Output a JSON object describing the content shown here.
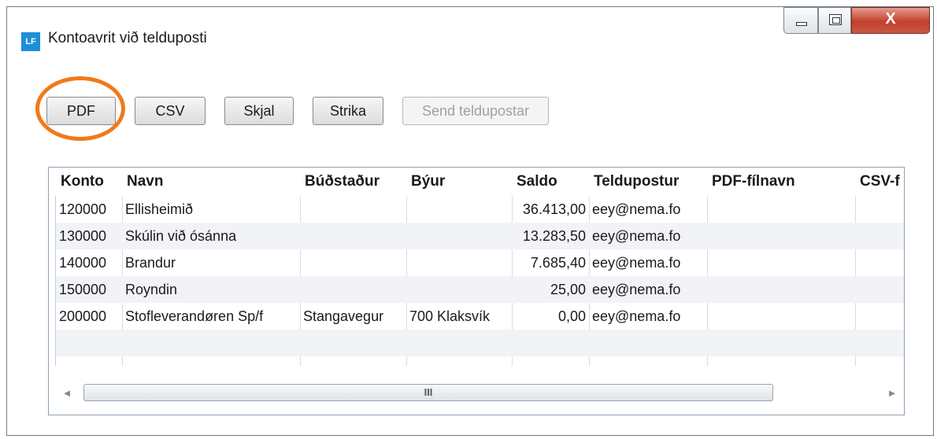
{
  "window": {
    "app_icon": "LF",
    "title": "Kontoavrit við telduposti",
    "controls": {
      "minimize": "minimize-icon",
      "maximize": "maximize-icon",
      "close_label": "X"
    }
  },
  "toolbar": {
    "pdf": "PDF",
    "csv": "CSV",
    "skjal": "Skjal",
    "strika": "Strika",
    "send": "Send teldupostar"
  },
  "highlight": {
    "target": "PDF",
    "color": "#f07a1a"
  },
  "grid": {
    "columns": [
      "Konto",
      "Navn",
      "Búðstaður",
      "Býur",
      "Saldo",
      "Teldupostur",
      "PDF-fílnavn",
      "CSV-f"
    ],
    "rows": [
      {
        "konto": "120000",
        "navn": "Ellisheimið",
        "budstadur": "",
        "byur": "",
        "saldo": "36.413,00",
        "email": "eey@nema.fo"
      },
      {
        "konto": "130000",
        "navn": "Skúlin við ósánna",
        "budstadur": "",
        "byur": "",
        "saldo": "13.283,50",
        "email": "eey@nema.fo"
      },
      {
        "konto": "140000",
        "navn": "Brandur",
        "budstadur": "",
        "byur": "",
        "saldo": "7.685,40",
        "email": "eey@nema.fo"
      },
      {
        "konto": "150000",
        "navn": "Royndin",
        "budstadur": "",
        "byur": "",
        "saldo": "25,00",
        "email": "eey@nema.fo"
      },
      {
        "konto": "200000",
        "navn": "Stofleverandøren Sp/f",
        "budstadur": "Stangavegur",
        "byur": "700 Klaksvík",
        "saldo": "0,00",
        "email": "eey@nema.fo"
      }
    ],
    "scrollbar": {
      "left_arrow": "◄",
      "right_arrow": "►",
      "thumb_grip": "III"
    }
  }
}
